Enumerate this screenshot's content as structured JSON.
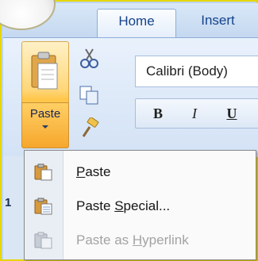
{
  "ribbon": {
    "tabs": [
      {
        "label": "Home",
        "active": true
      },
      {
        "label": "Insert",
        "active": false
      }
    ],
    "clipboard": {
      "paste_label": "Paste",
      "small_tools": [
        "cut-icon",
        "copy-icon",
        "format-painter-icon"
      ]
    },
    "font": {
      "font_name": "Calibri (Body)",
      "bold_label": "B",
      "italic_label": "I",
      "underline_label": "U"
    }
  },
  "sheet": {
    "row_number": "1"
  },
  "paste_menu": {
    "items": [
      {
        "pre": "",
        "accel": "P",
        "post": "aste",
        "enabled": true,
        "icon": "paste-icon"
      },
      {
        "pre": "Paste ",
        "accel": "S",
        "post": "pecial...",
        "enabled": true,
        "icon": "paste-special-icon"
      },
      {
        "pre": "Paste as ",
        "accel": "H",
        "post": "yperlink",
        "enabled": false,
        "icon": "paste-hyperlink-icon"
      }
    ]
  },
  "colors": {
    "accent_border": "#e5d600",
    "tab_text": "#15428b",
    "paste_highlight": "#ffc548"
  }
}
